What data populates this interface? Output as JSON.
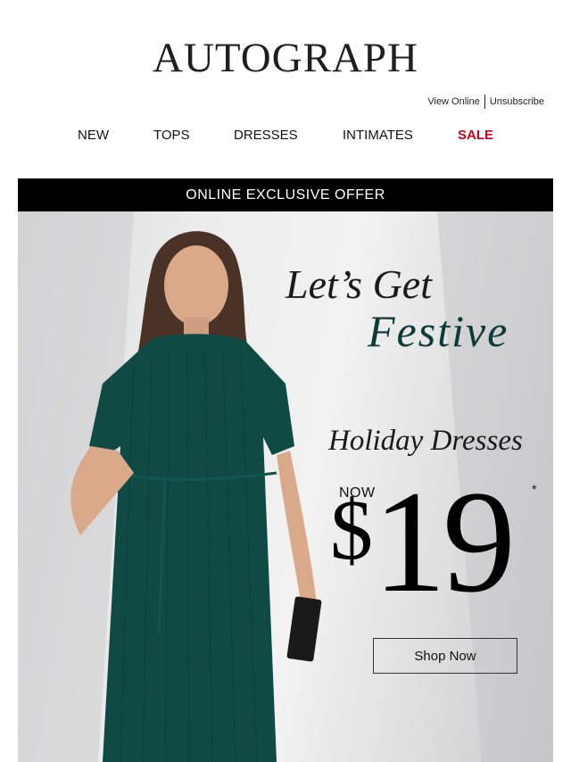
{
  "brand": {
    "logo_text": "AUTOGRAPH"
  },
  "utility": {
    "view_online": "View Online",
    "unsubscribe": "Unsubscribe"
  },
  "nav": {
    "new": "NEW",
    "tops": "TOPS",
    "dresses": "DRESSES",
    "intimates": "INTIMATES",
    "sale": "SALE"
  },
  "hero": {
    "banner": "ONLINE EXCLUSIVE OFFER",
    "headline_line1": "Let’s Get",
    "headline_line2": "Festive",
    "subhead": "Holiday Dresses",
    "now_label": "NOW",
    "price_currency": "$",
    "price_amount": "19",
    "price_asterisk": "*",
    "cta": "Shop Now"
  },
  "colors": {
    "sale": "#d0021b",
    "banner_bg": "#000000",
    "dress": "#0f4a45",
    "festive_text": "#0d3b38"
  }
}
